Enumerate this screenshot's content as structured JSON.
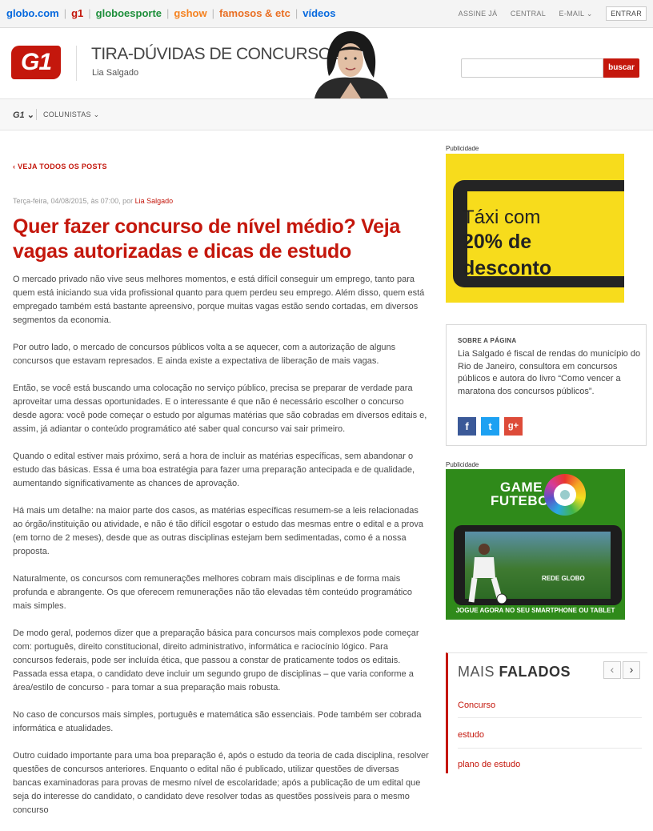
{
  "globobar": {
    "links": [
      "globo.com",
      "g1",
      "globoesporte",
      "gshow",
      "famosos & etc",
      "vídeos"
    ],
    "assine": "ASSINE JÁ",
    "central": "CENTRAL",
    "email": "E-MAIL",
    "entrar": "ENTRAR"
  },
  "header": {
    "logo": "G1",
    "blog_title": "TIRA-DÚVIDAS DE CONCURSOS",
    "author": "Lia Salgado",
    "search_placeholder": "",
    "search_button": "buscar"
  },
  "nav": {
    "g1": "G1",
    "colunistas": "COLUNISTAS"
  },
  "article": {
    "back": "VEJA TODOS OS POSTS",
    "date": "Terça-feira, 04/08/2015, às 07:00, por",
    "author": "Lia Salgado",
    "headline": "Quer fazer concurso de nível médio? Veja vagas autorizadas e dicas de estudo",
    "paragraphs": [
      "O mercado privado não vive seus melhores momentos, e está difícil conseguir um emprego, tanto para quem está iniciando sua vida profissional quanto para quem perdeu seu emprego. Além disso, quem está empregado também está bastante apreensivo, porque muitas vagas estão sendo cortadas, em diversos segmentos da economia.",
      "Por outro lado, o mercado de concursos públicos volta a se aquecer, com a autorização de alguns concursos que estavam represados. E ainda existe a expectativa de liberação de mais vagas.",
      "Então, se você está buscando uma colocação no serviço público, precisa se preparar de verdade para aproveitar uma dessas oportunidades. E o interessante é que não é necessário escolher o concurso desde agora: você pode começar o estudo por algumas matérias que são cobradas em diversos editais e, assim, já adiantar o conteúdo programático até saber qual concurso vai sair primeiro.",
      "Quando o edital estiver mais próximo, será a hora de incluir as matérias específicas, sem abandonar o estudo das básicas. Essa é uma boa estratégia para fazer uma preparação antecipada e de qualidade, aumentando significativamente as chances de aprovação.",
      "Há mais um detalhe: na maior parte dos casos, as matérias específicas resumem-se a leis relacionadas ao órgão/instituição ou atividade, e não é tão difícil esgotar o estudo das mesmas entre o edital e a prova (em torno de 2 meses), desde que as outras disciplinas estejam bem sedimentadas, como é a nossa proposta.",
      "Naturalmente, os concursos com remunerações melhores cobram mais disciplinas e de forma mais profunda e abrangente. Os que oferecem remunerações não tão elevadas têm conteúdo programático mais simples.",
      "De modo geral, podemos dizer que a preparação básica para concursos mais complexos pode começar com: português, direito constitucional, direito administrativo, informática e raciocínio lógico. Para concursos federais, pode ser incluída ética, que passou a constar de praticamente todos os editais. Passada essa etapa, o candidato deve incluir um segundo grupo de disciplinas – que varia conforme a área/estilo de concurso - para tomar a sua preparação mais robusta.",
      "No caso de concursos mais simples, português e matemática são essenciais. Pode também ser cobrada informática e atualidades.",
      "Outro cuidado importante para uma boa preparação é, após o estudo da teoria de cada disciplina, resolver questões de concursos anteriores. Enquanto o edital não é publicado, utilizar questões de diversas bancas examinadoras para provas de mesmo nível de escolaridade; após a publicação de um edital que seja do interesse do candidato, o candidato deve resolver todas as questões possíveis para o mesmo concurso"
    ]
  },
  "sidebar": {
    "publicidade": "Publicidade",
    "ad_taxi": {
      "line1": "Táxi com",
      "line2": "20% de",
      "line3": "desconto"
    },
    "about": {
      "title": "SOBRE A PÁGINA",
      "text": "Lia Salgado é fiscal de rendas do município do Rio de Janeiro, consultora em concursos públicos e autora do livro “Como vencer a maratona dos concursos públicos”."
    },
    "social": [
      {
        "icon": "f",
        "color": "#3b5998"
      },
      {
        "icon": "t",
        "color": "#1da1f2"
      },
      {
        "icon": "g+",
        "color": "#dd4b39"
      }
    ],
    "ad_game": {
      "title1": "GAME",
      "title2": "FUTEBOL",
      "rede": "REDE GLOBO",
      "cta": "JOGUE AGORA NO SEU SMARTPHONE OU TABLET"
    },
    "mais_falados": {
      "title_light": "MAIS",
      "title_bold": "FALADOS",
      "prev": "‹",
      "next": "›",
      "items": [
        "Concurso",
        "estudo",
        "plano de estudo"
      ]
    }
  }
}
